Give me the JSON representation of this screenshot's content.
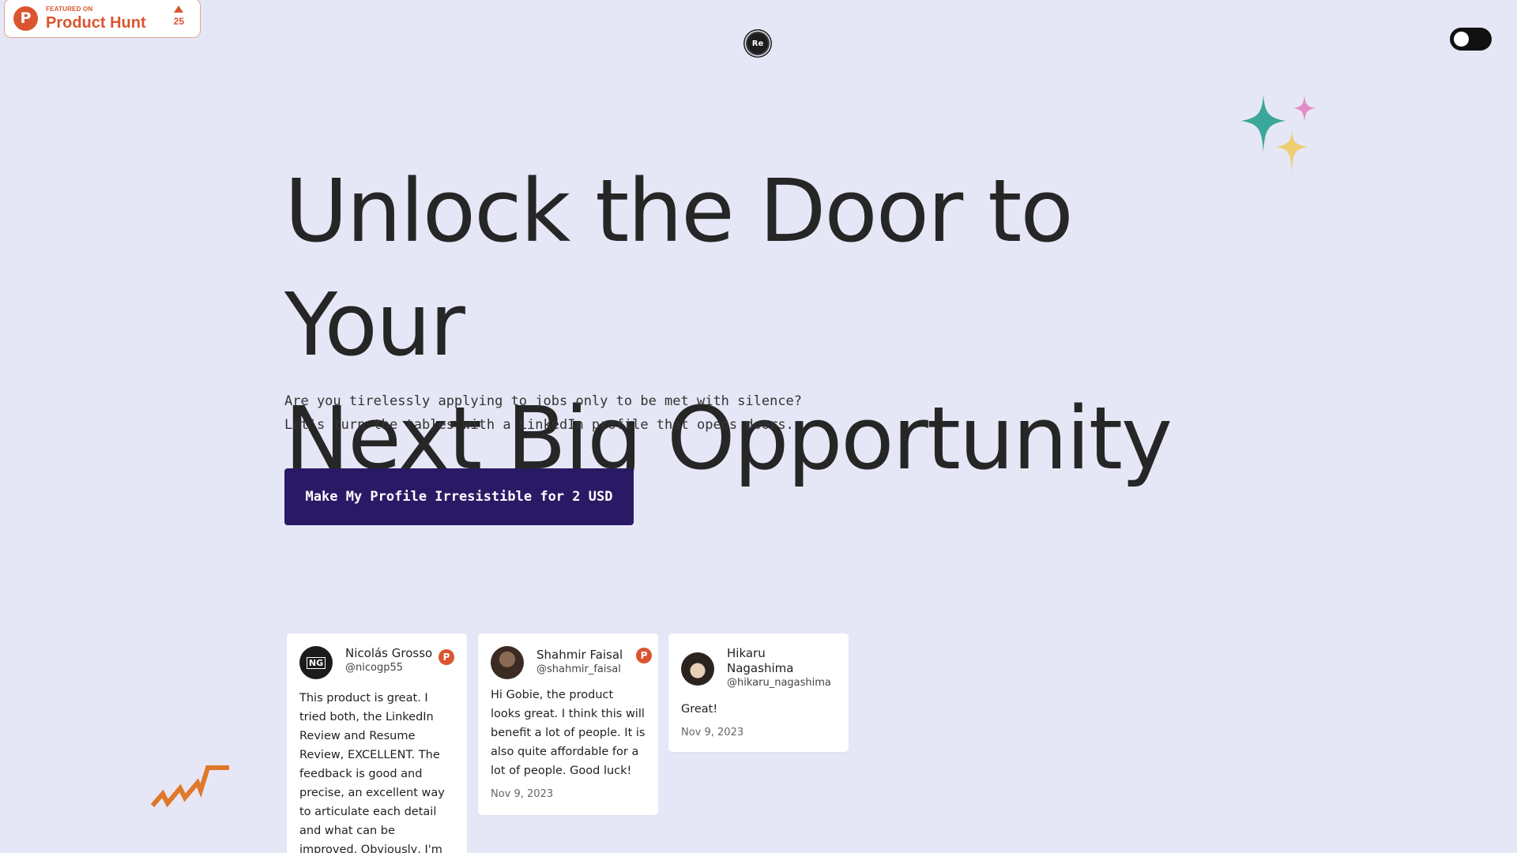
{
  "product_hunt": {
    "featured_label": "FEATURED ON",
    "name": "Product Hunt",
    "votes": "25"
  },
  "logo": {
    "text": "Re"
  },
  "theme_toggle": {
    "state": "off"
  },
  "hero": {
    "title_line1": "Unlock the Door to Your",
    "title_line2": "Next Big Opportunity",
    "sub_line1": "Are you tirelessly applying to jobs only to be met with silence?",
    "sub_line2": "Let's turn the tables with a LinkedIn profile that opens doors.",
    "cta_label": "Make My Profile Irresistible for 2 USD"
  },
  "testimonials": [
    {
      "name": "Nicolás Grosso",
      "handle": "@nicogp55",
      "avatar": "NG",
      "text": "This product is great. I tried both, the LinkedIn Review and Resume Review, EXCELLENT. The feedback is good and precise, an excellent way to articulate each detail and what can be improved. Obviously, I'm",
      "date": ""
    },
    {
      "name": "Shahmir Faisal",
      "handle": "@shahmir_faisal",
      "avatar": "",
      "text": "Hi Gobie, the product looks great. I think this will benefit a lot of people. It is also quite affordable for a lot of people. Good luck!",
      "date": "Nov 9, 2023"
    },
    {
      "name": "Hikaru Nagashima",
      "handle": "@hikaru_nagashima",
      "avatar": "",
      "text": "Great!",
      "date": "Nov 9, 2023"
    }
  ],
  "colors": {
    "background": "#e6e7f6",
    "cta": "#2a1a66",
    "product_hunt": "#da552f",
    "sparkle_teal": "#3aa79a",
    "sparkle_pink": "#e58bc4",
    "sparkle_yellow": "#efcd72",
    "squiggle": "#e0782a"
  }
}
